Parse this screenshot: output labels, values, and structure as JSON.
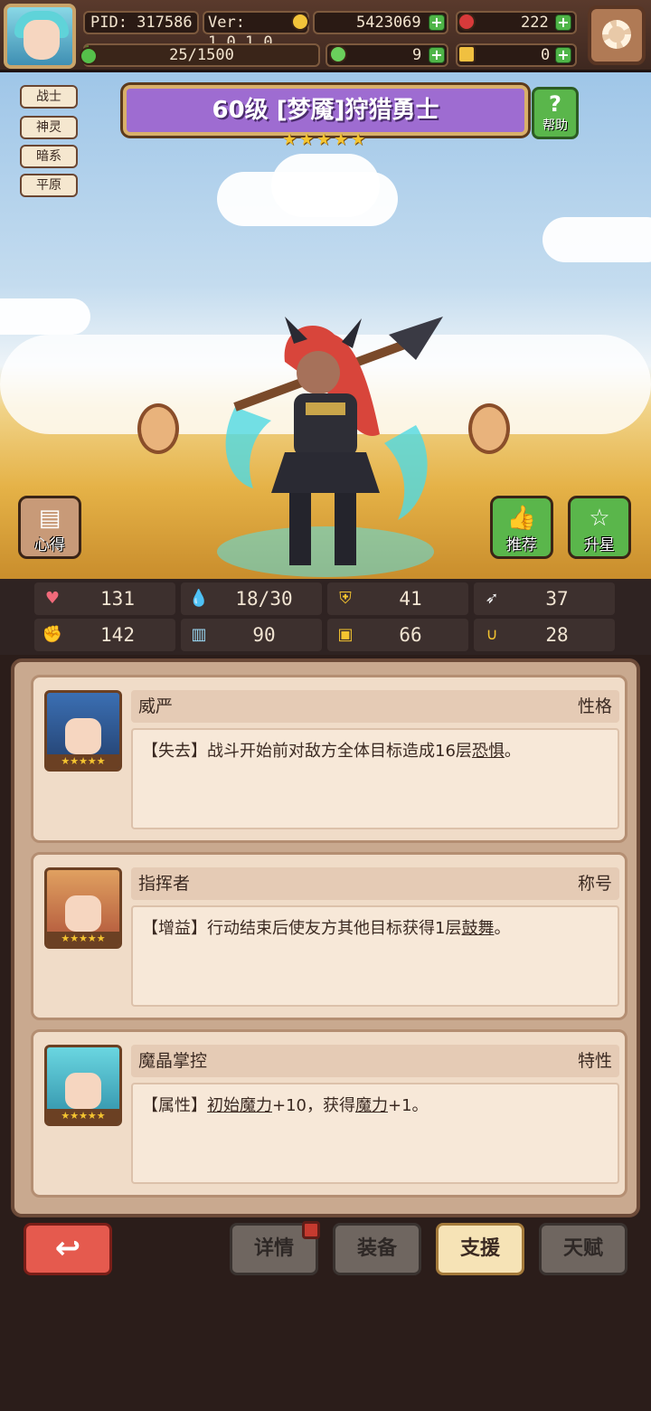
{
  "topbar": {
    "pid": "PID: 317586",
    "version": "Ver: 1.0.1.0",
    "gold": "5423069",
    "gems": "222",
    "xp": "25/1500",
    "xp_progress": 0.0167,
    "clovers": "9",
    "keys": "0"
  },
  "tags": [
    "战士",
    "神灵",
    "暗系",
    "平原"
  ],
  "hero": {
    "title": "60级 [梦魇]狩猎勇士",
    "stars": 5
  },
  "buttons": {
    "help": "帮助",
    "insight": "心得",
    "recommend": "推荐",
    "star_up": "升星"
  },
  "stats": [
    {
      "icon": "heart-icon",
      "value": "131"
    },
    {
      "icon": "water-drop-icon",
      "value": "18/30"
    },
    {
      "icon": "shield-icon",
      "value": "41"
    },
    {
      "icon": "wing-icon",
      "value": "37"
    },
    {
      "icon": "fist-icon",
      "value": "142"
    },
    {
      "icon": "book-icon",
      "value": "90"
    },
    {
      "icon": "armor-icon",
      "value": "66"
    },
    {
      "icon": "horseshoe-icon",
      "value": "28"
    }
  ],
  "cards": [
    {
      "name": "威严",
      "kind": "性格",
      "prefix": "【失去】战斗开始前对敌方全体目标造成16层",
      "link": "恐惧",
      "suffix": "。"
    },
    {
      "name": "指挥者",
      "kind": "称号",
      "prefix": "【增益】行动结束后使友方其他目标获得1层",
      "link": "鼓舞",
      "suffix": "。"
    },
    {
      "name": "魔晶掌控",
      "kind": "特性",
      "prefix": "【属性】",
      "link": "初始魔力",
      "mid": "+10，获得",
      "link2": "魔力",
      "suffix": "+1。"
    }
  ],
  "nav": {
    "back": "↩",
    "details": "详情",
    "equipment": "装备",
    "support": "支援",
    "talent": "天赋"
  }
}
